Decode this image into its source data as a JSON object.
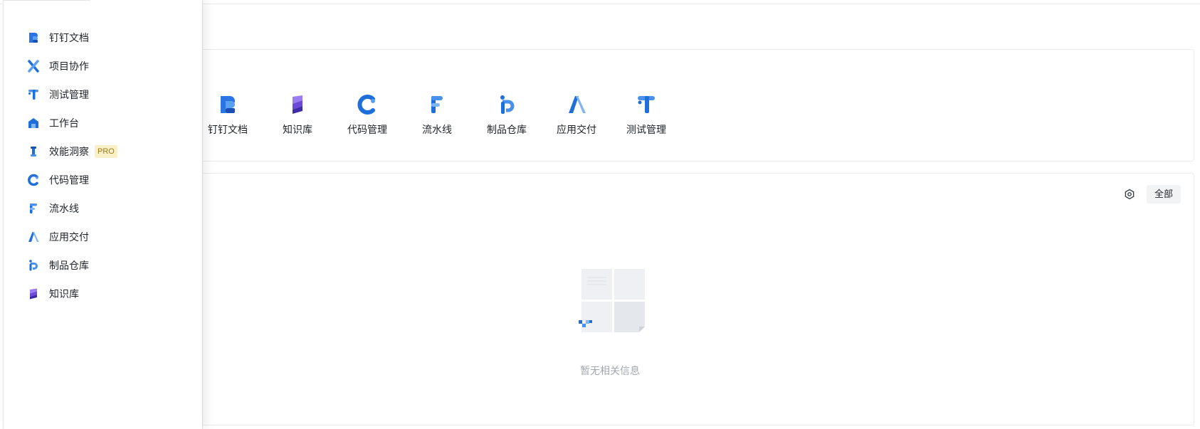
{
  "sidebar": {
    "items": [
      {
        "label": "钉钉文档",
        "icon": "dingtalk-docs-icon"
      },
      {
        "label": "项目协作",
        "icon": "project-collab-icon"
      },
      {
        "label": "测试管理",
        "icon": "test-management-icon"
      },
      {
        "label": "工作台",
        "icon": "workbench-icon"
      },
      {
        "label": "效能洞察",
        "icon": "insight-icon",
        "badge": "PRO"
      },
      {
        "label": "代码管理",
        "icon": "code-management-icon"
      },
      {
        "label": "流水线",
        "icon": "pipeline-icon"
      },
      {
        "label": "应用交付",
        "icon": "app-delivery-icon"
      },
      {
        "label": "制品仓库",
        "icon": "artifact-repo-icon"
      },
      {
        "label": "知识库",
        "icon": "knowledge-base-icon"
      }
    ]
  },
  "apps": {
    "tiles": [
      {
        "label": "钉钉文档",
        "icon": "dingtalk-docs-icon"
      },
      {
        "label": "知识库",
        "icon": "knowledge-base-icon"
      },
      {
        "label": "代码管理",
        "icon": "code-management-icon"
      },
      {
        "label": "流水线",
        "icon": "pipeline-icon"
      },
      {
        "label": "制品仓库",
        "icon": "artifact-repo-icon"
      },
      {
        "label": "应用交付",
        "icon": "app-delivery-icon"
      },
      {
        "label": "测试管理",
        "icon": "test-management-icon"
      }
    ]
  },
  "info_card": {
    "filter_label": "全部",
    "settings_icon": "settings-hex-icon",
    "empty_text": "暂无相关信息",
    "empty_icon": "empty-state-illustration"
  },
  "colors": {
    "brand_blue": "#1e6fd9",
    "brand_purple": "#6a4ad6",
    "pro_badge_bg": "#faf0c8",
    "pro_badge_text": "#a07a16"
  }
}
